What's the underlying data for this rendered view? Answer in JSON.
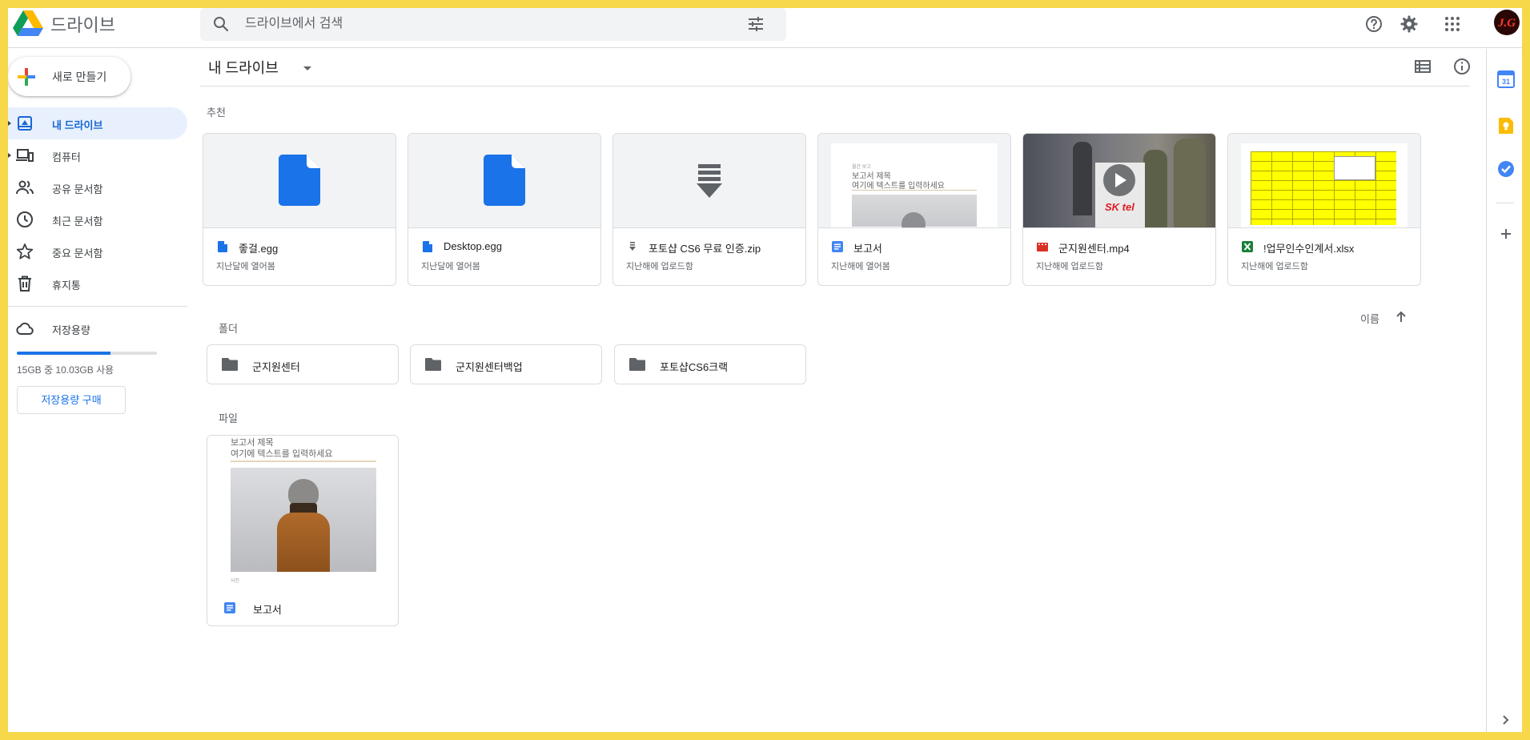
{
  "app": {
    "title": "드라이브"
  },
  "search": {
    "placeholder": "드라이브에서 검색"
  },
  "user": {
    "avatar_text": "J.G"
  },
  "nav": {
    "new_label": "새로 만들기",
    "items": [
      {
        "label": "내 드라이브",
        "active": true
      },
      {
        "label": "컴퓨터"
      },
      {
        "label": "공유 문서함"
      },
      {
        "label": "최근 문서함"
      },
      {
        "label": "중요 문서함"
      },
      {
        "label": "휴지통"
      }
    ],
    "storage": {
      "label": "저장용량",
      "usage_text": "15GB 중 10.03GB 사용",
      "used_fraction": 0.67,
      "buy_label": "저장용량 구매"
    }
  },
  "main": {
    "title": "내 드라이브",
    "suggested_label": "추천",
    "suggested": [
      {
        "name": "좋걸.egg",
        "sub": "지난달에 열어봄",
        "type": "file-blue"
      },
      {
        "name": "Desktop.egg",
        "sub": "지난달에 열어봄",
        "type": "file-blue"
      },
      {
        "name": "포토샵 CS6 무료 인증.zip",
        "sub": "지난해에 업로드함",
        "type": "zip"
      },
      {
        "name": "보고서",
        "sub": "지난해에 열어봄",
        "type": "docs"
      },
      {
        "name": "군지원센터.mp4",
        "sub": "지난해에 업로드함",
        "type": "video"
      },
      {
        "name": "!업무인수인계서.xlsx",
        "sub": "지난해에 업로드함",
        "type": "excel"
      }
    ],
    "preview_text": {
      "doc_small": "월간 보고",
      "doc_title": "보고서 제목",
      "doc_body": "여기에 텍스트를 입력하세요",
      "video_brand": "SK tel",
      "file_caption": "사진"
    },
    "folders_label": "폴더",
    "sort_label": "이름",
    "folders": [
      {
        "name": "군지원센터"
      },
      {
        "name": "군지원센터백업"
      },
      {
        "name": "포토샵CS6크랙"
      }
    ],
    "files_label": "파일",
    "files": [
      {
        "name": "보고서"
      }
    ]
  },
  "colors": {
    "accent": "#1a73e8",
    "frame": "#f6d84a",
    "folder": "#5f6368",
    "excel": "#188038",
    "video": "#d93025"
  }
}
